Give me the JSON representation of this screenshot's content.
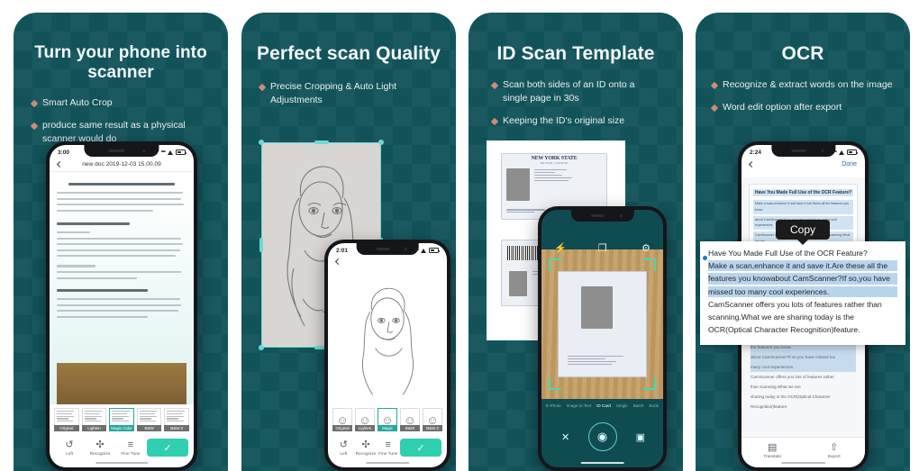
{
  "theme": {
    "panel_bg": "#12535a",
    "accent": "#28a59b",
    "bullet_diamond": "#cf8a7a",
    "crop_handle": "#6fd8d2",
    "page_bg": "#ffffff"
  },
  "panels": [
    {
      "id": "panel-1",
      "headline": "Turn your phone into scanner",
      "bullets": [
        "Smart Auto Crop",
        "produce same result as a physical scanner would do"
      ],
      "phone": {
        "status_time": "3:00",
        "nav_title": "new doc 2019-12-03 15.00.09",
        "doc_heading": "Have You Made Full Use of the OCR Feature?",
        "doc_subheading": "What can you do with OCR feature?",
        "doc_section": "1.Searching",
        "doc_section2": "2.Text extraction",
        "filters": [
          {
            "label": "Original",
            "selected": false
          },
          {
            "label": "Lighten",
            "selected": false
          },
          {
            "label": "Magic Color",
            "selected": true
          },
          {
            "label": "B&W",
            "selected": false
          },
          {
            "label": "B&W 2",
            "selected": false
          }
        ],
        "tools": [
          {
            "icon": "rotate-left-icon",
            "glyph": "↺",
            "label": "Left"
          },
          {
            "icon": "recognize-icon",
            "glyph": "✣",
            "label": "Recognize"
          },
          {
            "icon": "fine-tune-icon",
            "glyph": "≡",
            "label": "Fine Tune"
          }
        ],
        "confirm": {
          "icon": "check-icon",
          "glyph": "✓"
        }
      }
    },
    {
      "id": "panel-2",
      "headline": "Perfect scan Quality",
      "bullets": [
        "Precise Cropping & Auto Light Adjustments"
      ],
      "phone": {
        "status_time": "2:01",
        "filters": [
          {
            "label": "Original",
            "selected": false
          },
          {
            "label": "Lighten",
            "selected": false
          },
          {
            "label": "Magic Color",
            "selected": true
          },
          {
            "label": "B&W",
            "selected": false
          },
          {
            "label": "B&W 2",
            "selected": false
          }
        ],
        "tools": [
          {
            "icon": "rotate-left-icon",
            "glyph": "↺",
            "label": "Left"
          },
          {
            "icon": "recognize-icon",
            "glyph": "✣",
            "label": "Recognize"
          },
          {
            "icon": "fine-tune-icon",
            "glyph": "≡",
            "label": "Fine Tune"
          }
        ],
        "confirm": {
          "icon": "check-icon",
          "glyph": "✓"
        }
      }
    },
    {
      "id": "panel-3",
      "headline": "ID Scan Template",
      "bullets": [
        "Scan both sides of an ID onto a single page in 30s",
        "Keeping the ID's original size"
      ],
      "phone": {
        "top_icons": [
          {
            "icon": "flash-icon",
            "glyph": "⚡"
          },
          {
            "icon": "id-template-icon",
            "glyph": "❐"
          },
          {
            "icon": "settings-icon",
            "glyph": "⚙"
          }
        ],
        "modes": [
          {
            "label": "E-Photo",
            "active": false
          },
          {
            "label": "Image to Text",
            "active": false
          },
          {
            "label": "ID Card",
            "active": true
          },
          {
            "label": "Single",
            "active": false
          },
          {
            "label": "Batch",
            "active": false
          },
          {
            "label": "Book",
            "active": false
          }
        ],
        "bottom_icons": [
          {
            "icon": "close-icon",
            "glyph": "✕"
          },
          {
            "icon": "shutter-icon",
            "glyph": "◎"
          },
          {
            "icon": "gallery-icon",
            "glyph": "ὛC"
          }
        ]
      },
      "id_card": {
        "state_title": "NEW YORK STATE",
        "subtitle": "DRIVER LICENSE",
        "id_number": "123 456 789",
        "name_line1": "MOTORIST",
        "name_line2": "MICHAEL M",
        "addr_line1": "2345 ANYWHERE STREET",
        "addr_line2": "YOUR CITY NY 12345"
      }
    },
    {
      "id": "panel-4",
      "headline": "OCR",
      "bullets": [
        "Recognize & extract words on the image",
        "Word edit option after export"
      ],
      "phone": {
        "status_time": "2:24",
        "nav_done": "Done",
        "ocr_title": "Have You Made Full Use of the OCR Feature?",
        "ocr_lines": [
          {
            "text": "Make a scan,enhance it and save it.Are these all the features you know",
            "highlight": true
          },
          {
            "text": "about CamScanner?If so,you have missed too many cool experiences.",
            "highlight": true
          },
          {
            "text": "CamScanner offers you lots of features rather than scanning.What we are",
            "highlight": false
          },
          {
            "text": "sharing today is the OCR(Optical Character Recognition)feature.",
            "highlight": false
          }
        ],
        "bottom_actions": [
          {
            "icon": "translate-icon",
            "glyph": "文",
            "label": "Translate"
          },
          {
            "icon": "export-icon",
            "glyph": "⇧",
            "label": "Export"
          }
        ]
      },
      "callout": {
        "tooltip": "Copy",
        "title": "Have You Made Full Use of the OCR Feature?",
        "paragraphs": [
          {
            "text": "Make a scan,enhance it and save it.Are these all the",
            "selected": true
          },
          {
            "text": "features you knowabout CamScanner?If so,you have",
            "selected": true
          },
          {
            "text": "missed too many cool experiences.",
            "selected": true
          },
          {
            "text": "CamScanner offers you lots of features rather than",
            "selected": false
          },
          {
            "text": "scanning.What we are sharing today is the",
            "selected": false
          },
          {
            "text": "OCR(Optical Character Recognition)feature.",
            "selected": false
          }
        ]
      }
    }
  ]
}
